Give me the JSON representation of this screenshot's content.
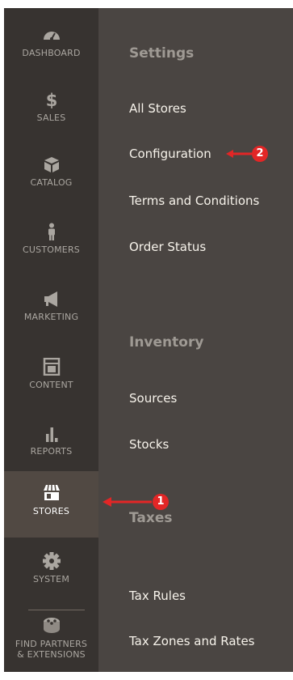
{
  "sidebar": {
    "items": [
      {
        "label": "DASHBOARD",
        "icon": "speedometer-icon"
      },
      {
        "label": "SALES",
        "icon": "dollar-icon"
      },
      {
        "label": "CATALOG",
        "icon": "box-icon"
      },
      {
        "label": "CUSTOMERS",
        "icon": "person-icon"
      },
      {
        "label": "MARKETING",
        "icon": "megaphone-icon"
      },
      {
        "label": "CONTENT",
        "icon": "layout-icon"
      },
      {
        "label": "REPORTS",
        "icon": "bar-chart-icon"
      },
      {
        "label": "STORES",
        "icon": "storefront-icon",
        "active": true
      },
      {
        "label": "SYSTEM",
        "icon": "gear-icon"
      },
      {
        "label": "FIND PARTNERS",
        "label2": "& EXTENSIONS",
        "icon": "blocks-icon"
      }
    ]
  },
  "panel": {
    "sections": [
      {
        "title": "Settings",
        "links": [
          "All Stores",
          "Configuration",
          "Terms and Conditions",
          "Order Status"
        ]
      },
      {
        "title": "Inventory",
        "links": [
          "Sources",
          "Stocks"
        ]
      },
      {
        "title": "Taxes",
        "links": [
          "Tax Rules",
          "Tax Zones and Rates"
        ]
      }
    ]
  },
  "annotations": {
    "badge_1": "1",
    "badge_2": "2"
  },
  "colors": {
    "sidebar_bg": "#373330",
    "sidebar_active_bg": "#514943",
    "panel_bg": "#4a4542",
    "section_title": "#9f9a94",
    "link_text": "#f7f3eb",
    "annotation": "#e22626"
  }
}
